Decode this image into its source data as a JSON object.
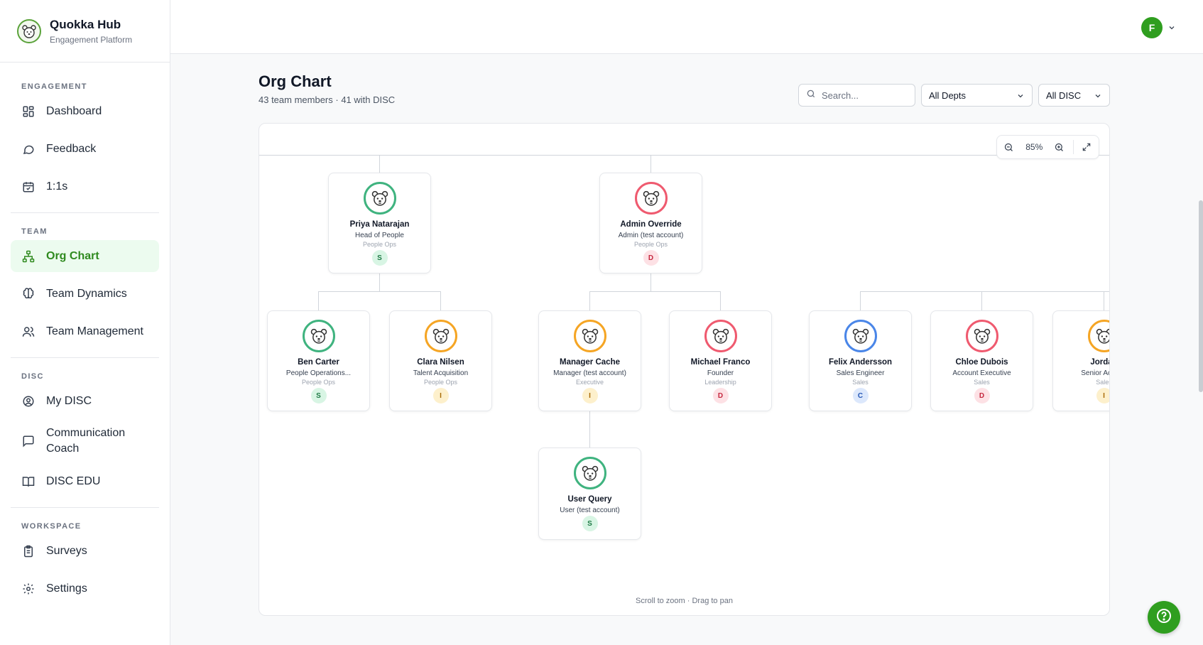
{
  "brand": {
    "title": "Quokka Hub",
    "subtitle": "Engagement Platform"
  },
  "sidebar": {
    "sections": [
      {
        "label": "ENGAGEMENT",
        "items": [
          {
            "label": "Dashboard",
            "icon": "dashboard-icon"
          },
          {
            "label": "Feedback",
            "icon": "chat-bubble-icon"
          },
          {
            "label": "1:1s",
            "icon": "calendar-check-icon"
          }
        ]
      },
      {
        "label": "TEAM",
        "items": [
          {
            "label": "Org Chart",
            "icon": "org-chart-icon",
            "active": true
          },
          {
            "label": "Team Dynamics",
            "icon": "brain-icon"
          },
          {
            "label": "Team Management",
            "icon": "users-icon"
          }
        ]
      },
      {
        "label": "DISC",
        "items": [
          {
            "label": "My DISC",
            "icon": "user-circle-icon"
          },
          {
            "label": "Communication Coach",
            "icon": "message-square-icon"
          },
          {
            "label": "DISC EDU",
            "icon": "book-open-icon"
          }
        ]
      },
      {
        "label": "WORKSPACE",
        "items": [
          {
            "label": "Surveys",
            "icon": "clipboard-icon"
          },
          {
            "label": "Settings",
            "icon": "gear-icon"
          }
        ]
      }
    ]
  },
  "user": {
    "initial": "F",
    "color": "#2f9e1f"
  },
  "header": {
    "title": "Org Chart",
    "subtitle": "43 team members · 41 with DISC",
    "search_placeholder": "Search...",
    "dept_filter": "All Depts",
    "disc_filter": "All DISC"
  },
  "chart": {
    "zoom": "85%",
    "hint": "Scroll to zoom · Drag to pan",
    "disc_colors": {
      "S": {
        "ring": "#3fb37f",
        "bg": "#d8f5e4",
        "fg": "#1f7a45"
      },
      "D": {
        "ring": "#ef5a6f",
        "bg": "#fde1e5",
        "fg": "#c5283f"
      },
      "I": {
        "ring": "#f5a524",
        "bg": "#fdf0cc",
        "fg": "#a86a05"
      },
      "C": {
        "ring": "#4a86e8",
        "bg": "#dce8fc",
        "fg": "#2457b5"
      }
    },
    "people": [
      {
        "name": "Priya Natarajan",
        "role": "Head of People",
        "dept": "People Ops",
        "disc": "S"
      },
      {
        "name": "Admin Override",
        "role": "Admin (test account)",
        "dept": "People Ops",
        "disc": "D"
      },
      {
        "name": "Ben Carter",
        "role": "People Operations...",
        "dept": "People Ops",
        "disc": "S"
      },
      {
        "name": "Clara Nilsen",
        "role": "Talent Acquisition",
        "dept": "People Ops",
        "disc": "I"
      },
      {
        "name": "Manager Cache",
        "role": "Manager (test account)",
        "dept": "Executive",
        "disc": "I"
      },
      {
        "name": "Michael Franco",
        "role": "Founder",
        "dept": "Leadership",
        "disc": "D"
      },
      {
        "name": "Felix Andersson",
        "role": "Sales Engineer",
        "dept": "Sales",
        "disc": "C"
      },
      {
        "name": "Chloe Dubois",
        "role": "Account Executive",
        "dept": "Sales",
        "disc": "D"
      },
      {
        "name": "Jordan",
        "role": "Senior Accoun",
        "dept": "Sales",
        "disc": "I"
      },
      {
        "name": "User Query",
        "role": "User (test account)",
        "dept": "",
        "disc": "S"
      }
    ]
  }
}
